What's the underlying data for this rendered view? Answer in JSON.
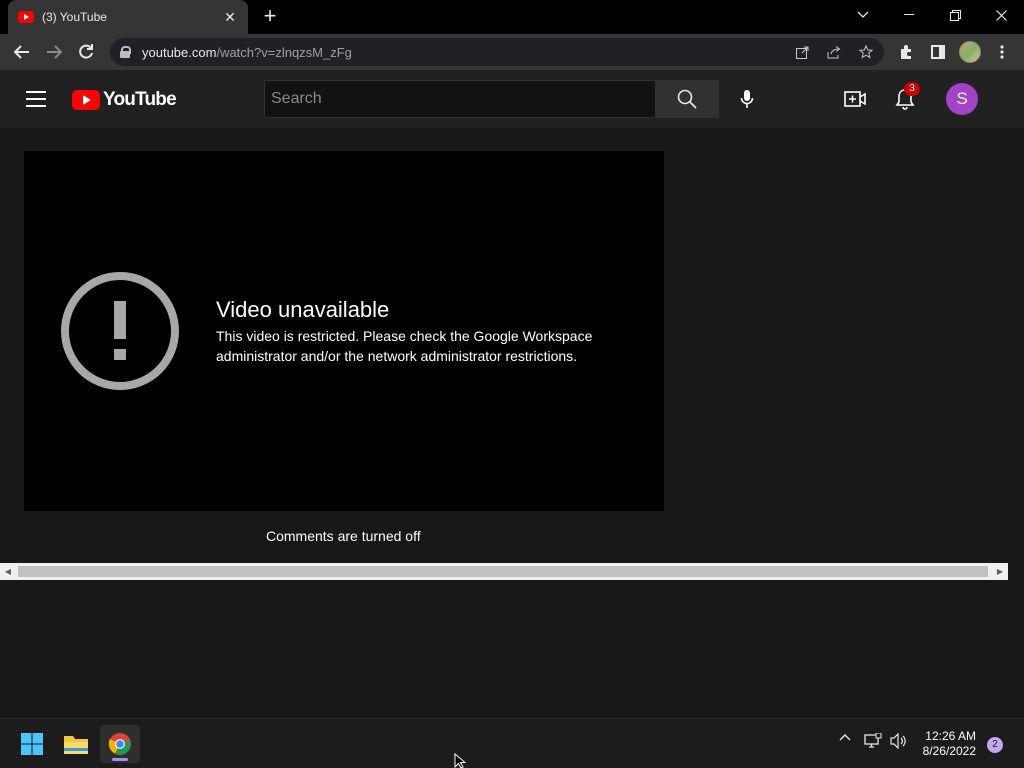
{
  "browser": {
    "tab_title": "(3) YouTube",
    "tab_close": "✕",
    "new_tab": "+",
    "url_host": "youtube.com",
    "url_path": "/watch?v=zlnqzsM_zFg"
  },
  "youtube": {
    "logo_text": "YouTube",
    "search_placeholder": "Search",
    "notification_count": "3",
    "account_initial": "S"
  },
  "player": {
    "error_title": "Video unavailable",
    "error_message": "This video is restricted. Please check the Google Workspace administrator and/or the network administrator restrictions."
  },
  "comments": {
    "status": "Comments are turned off"
  },
  "taskbar": {
    "time": "12:26 AM",
    "date": "8/26/2022",
    "notification_count": "2"
  },
  "colors": {
    "youtube_red": "#ff0000",
    "account_purple": "#a142c7",
    "badge_red": "#cc0000"
  },
  "icons": [
    "youtube-favicon-icon",
    "back-arrow-icon",
    "forward-arrow-icon",
    "reload-icon",
    "lock-icon",
    "open-in-app-icon",
    "share-icon",
    "bookmark-star-icon",
    "extensions-icon",
    "side-panel-icon",
    "kebab-menu-icon",
    "hamburger-icon",
    "search-icon",
    "microphone-icon",
    "create-video-icon",
    "bell-icon",
    "error-exclamation-icon",
    "windows-start-icon",
    "file-explorer-icon",
    "chrome-icon",
    "chevron-up-icon",
    "network-icon",
    "volume-icon"
  ]
}
